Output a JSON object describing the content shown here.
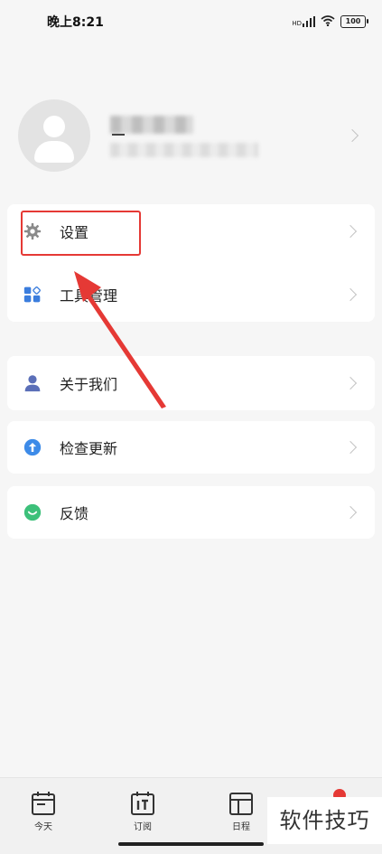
{
  "status_bar": {
    "time": "晚上8:21",
    "network_label": "HD",
    "battery": "100"
  },
  "menu": {
    "settings": "设置",
    "tools": "工具管理",
    "about": "关于我们",
    "update": "检查更新",
    "feedback": "反馈"
  },
  "bottom_nav": {
    "today": "今天",
    "subscribe": "订阅",
    "schedule": "日程"
  },
  "watermark": "软件技巧",
  "colors": {
    "annotation_red": "#e53935",
    "icon_gray": "#8a8a8a",
    "tools_blue": "#3b7ddd",
    "about_blue": "#5b6fb8",
    "update_blue": "#3d8be8",
    "feedback_green": "#3dc07a"
  },
  "icons": {
    "settings": "gear-icon",
    "tools": "grid-icon",
    "about": "person-icon",
    "update": "arrow-up-circle-icon",
    "feedback": "check-circle-icon",
    "today": "calendar-icon",
    "subscribe": "subscribe-calendar-icon",
    "schedule": "layout-icon"
  }
}
